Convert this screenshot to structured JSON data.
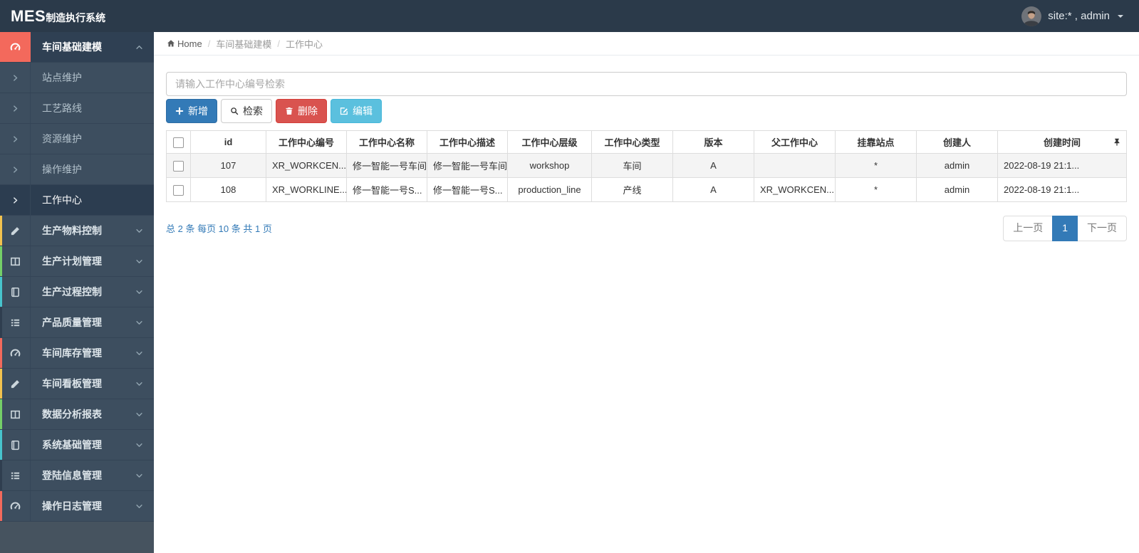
{
  "colors": {
    "navbar_bg": "#2b3a4a",
    "sidebar_bg": "#3d4e5f",
    "accent_salmon": "#f3695c",
    "primary_blue": "#337ab7",
    "danger_red": "#d9534f",
    "info_cyan": "#5bc0de",
    "pagination_active": "#337ab7"
  },
  "navbar": {
    "logo_bold": "MES",
    "logo_rest": "制造执行系统",
    "user_label": "site:* , admin"
  },
  "breadcrumb": {
    "home": "Home",
    "section": "车间基础建模",
    "current": "工作中心"
  },
  "sidebar": {
    "active_group": {
      "label": "车间基础建模"
    },
    "submenu": [
      {
        "label": "站点维护"
      },
      {
        "label": "工艺路线"
      },
      {
        "label": "资源维护"
      },
      {
        "label": "操作维护"
      },
      {
        "label": "工作中心"
      }
    ],
    "groups": [
      {
        "label": "生产物料控制",
        "icon": "pencil-icon",
        "strip_color": "#f2c24e"
      },
      {
        "label": "生产计划管理",
        "icon": "columns-icon",
        "strip_color": "#74cf68"
      },
      {
        "label": "生产过程控制",
        "icon": "book-icon",
        "strip_color": "#47c4cd"
      },
      {
        "label": "产品质量管理",
        "icon": "list-icon",
        "strip_color": "#2f3e4f"
      },
      {
        "label": "车间库存管理",
        "icon": "dashboard-icon",
        "strip_color": "#f3695c"
      },
      {
        "label": "车间看板管理",
        "icon": "pencil-icon",
        "strip_color": "#f2c24e"
      },
      {
        "label": "数据分析报表",
        "icon": "columns-icon",
        "strip_color": "#74cf68"
      },
      {
        "label": "系统基础管理",
        "icon": "book-icon",
        "strip_color": "#47c4cd"
      },
      {
        "label": "登陆信息管理",
        "icon": "list-icon",
        "strip_color": "#2f3e4f"
      },
      {
        "label": "操作日志管理",
        "icon": "dashboard-icon",
        "strip_color": "#f3695c"
      }
    ]
  },
  "toolbar": {
    "search_placeholder": "请输入工作中心编号检索",
    "add_label": "新增",
    "search_label": "检索",
    "delete_label": "删除",
    "edit_label": "编辑"
  },
  "table": {
    "headers": [
      "id",
      "工作中心编号",
      "工作中心名称",
      "工作中心描述",
      "工作中心层级",
      "工作中心类型",
      "版本",
      "父工作中心",
      "挂靠站点",
      "创建人",
      "创建时间"
    ],
    "rows": [
      {
        "cells": [
          "107",
          "XR_WORKCEN...",
          "修一智能一号车间",
          "修一智能一号车间",
          "workshop",
          "车间",
          "A",
          "",
          "*",
          "admin",
          "2022-08-19 21:1..."
        ]
      },
      {
        "cells": [
          "108",
          "XR_WORKLINE...",
          "修一智能一号S...",
          "修一智能一号S...",
          "production_line",
          "产线",
          "A",
          "XR_WORKCEN...",
          "*",
          "admin",
          "2022-08-19 21:1..."
        ]
      }
    ]
  },
  "pagination": {
    "info": "总 2 条 每页 10 条 共 1 页",
    "prev": "上一页",
    "page": "1",
    "next": "下一页"
  }
}
